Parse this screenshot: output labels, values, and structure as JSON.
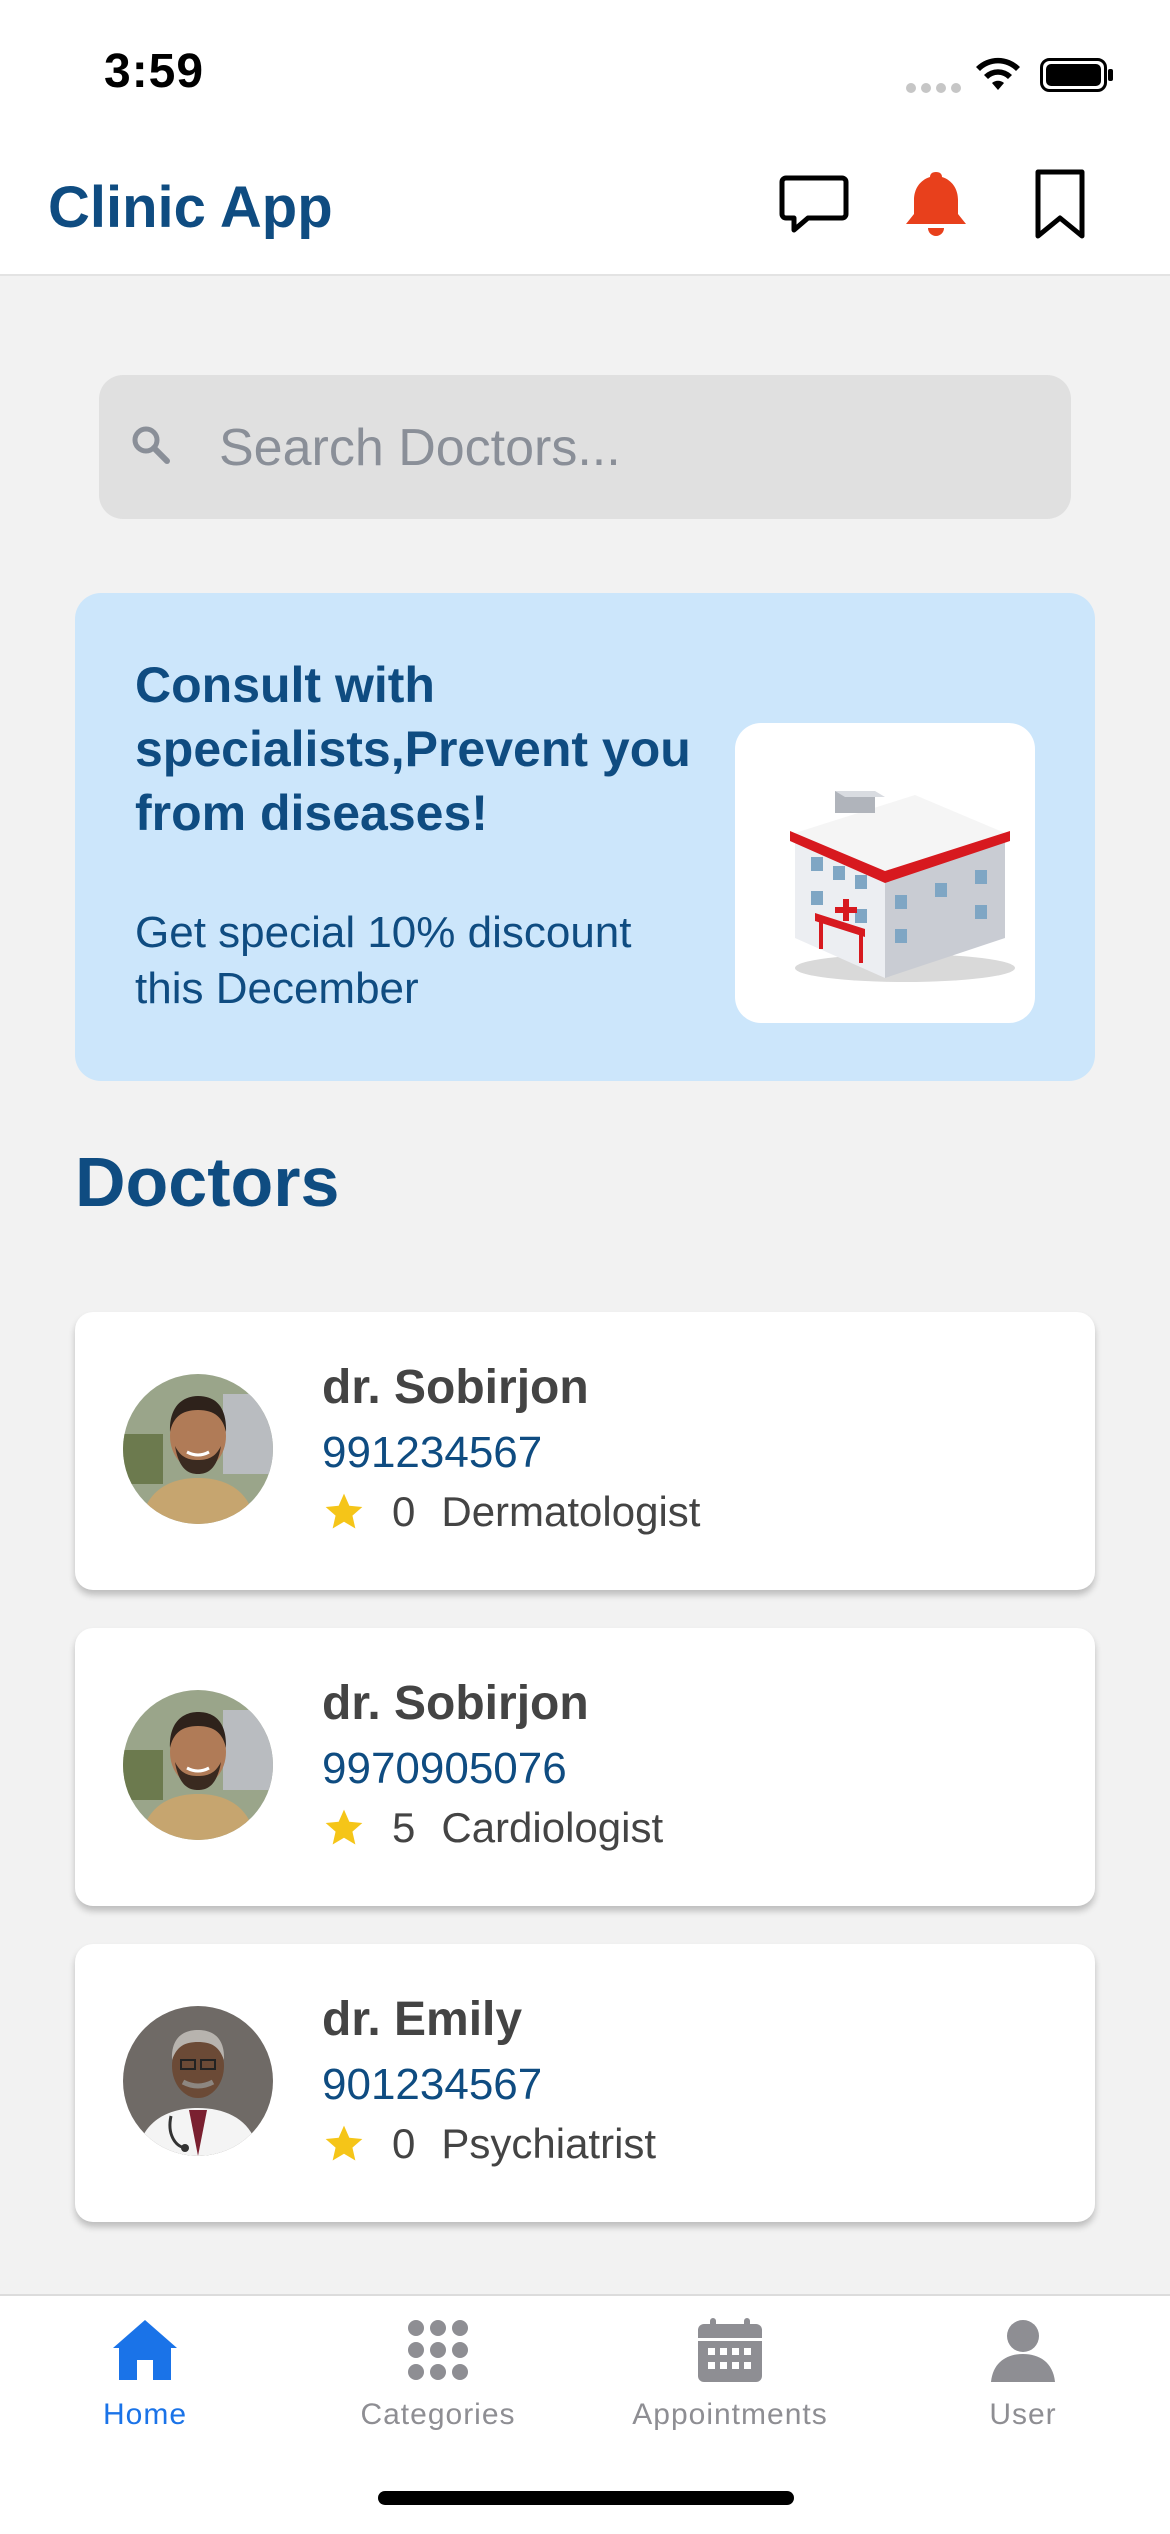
{
  "status_bar": {
    "time": "3:59"
  },
  "header": {
    "title": "Clinic App",
    "icons": [
      "chat-icon",
      "bell-icon",
      "bookmark-icon"
    ],
    "bell_color": "#e8401c"
  },
  "search": {
    "placeholder": "Search Doctors..."
  },
  "banner": {
    "title": "Consult with specialists,Prevent you from diseases!",
    "subtitle": "Get special 10% discount this December",
    "image": "hospital-building-icon"
  },
  "doctors_section": {
    "title": "Doctors",
    "items": [
      {
        "name": "dr. Sobirjon",
        "phone": "991234567",
        "rating": "0",
        "specialty": "Dermatologist",
        "avatar": "avatar-man-beard"
      },
      {
        "name": "dr. Sobirjon",
        "phone": "9970905076",
        "rating": "5",
        "specialty": "Cardiologist",
        "avatar": "avatar-man-beard"
      },
      {
        "name": "dr. Emily",
        "phone": "901234567",
        "rating": "0",
        "specialty": "Psychiatrist",
        "avatar": "avatar-doctor-coat"
      }
    ]
  },
  "tabbar": {
    "active": "Home",
    "items": [
      {
        "label": "Home",
        "icon": "home-icon"
      },
      {
        "label": "Categories",
        "icon": "grid-icon"
      },
      {
        "label": "Appointments",
        "icon": "calendar-icon"
      },
      {
        "label": "User",
        "icon": "user-icon"
      }
    ]
  },
  "colors": {
    "primary": "#0f4c81",
    "accent": "#1a73e8",
    "banner_bg": "#cce6fb",
    "star": "#f5c518"
  }
}
